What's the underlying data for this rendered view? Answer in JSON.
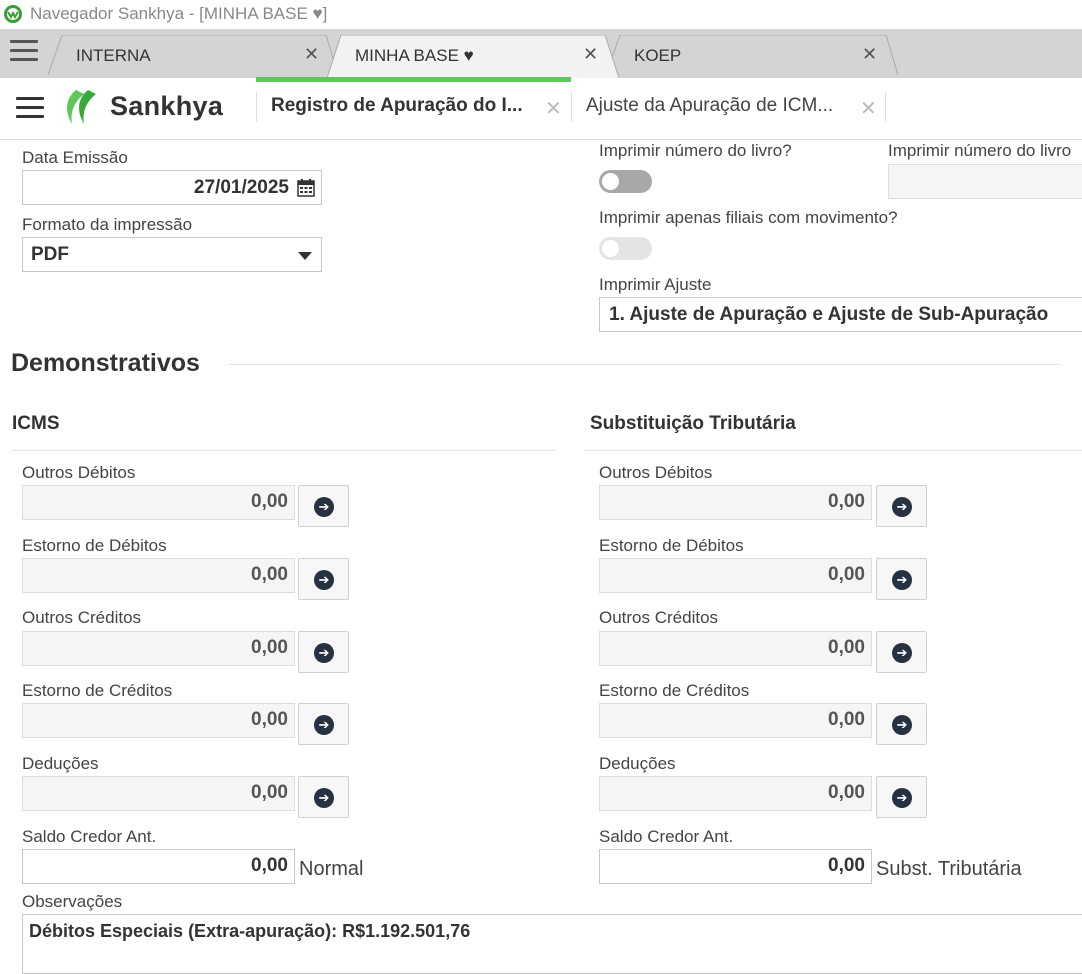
{
  "window": {
    "title": "Navegador Sankhya - [MINHA BASE ♥]"
  },
  "browser_tabs": [
    {
      "label": "INTERNA"
    },
    {
      "label": "MINHA BASE ♥"
    },
    {
      "label": "KOEP"
    }
  ],
  "app": {
    "brand": "Sankhya",
    "tabs": [
      {
        "label": "Registro de Apuração do I..."
      },
      {
        "label": "Ajuste da Apuração de ICM..."
      }
    ]
  },
  "form": {
    "data_emissao_label": "Data Emissão",
    "data_emissao_value": "27/01/2025",
    "formato_label": "Formato da impressão",
    "formato_value": "PDF",
    "imprimir_numero_label": "Imprimir número do livro?",
    "imprimir_numero_livro_label": "Imprimir número do livro",
    "imprimir_filiais_label": "Imprimir apenas filiais com movimento?",
    "imprimir_ajuste_label": "Imprimir Ajuste",
    "imprimir_ajuste_value": "1. Ajuste de Apuração e Ajuste de Sub-Apuração"
  },
  "demonstrativos": {
    "title": "Demonstrativos",
    "icms": {
      "title": "ICMS",
      "fields": [
        {
          "label": "Outros Débitos",
          "value": "0,00"
        },
        {
          "label": "Estorno de Débitos",
          "value": "0,00"
        },
        {
          "label": "Outros Créditos",
          "value": "0,00"
        },
        {
          "label": "Estorno de Créditos",
          "value": "0,00"
        },
        {
          "label": "Deduções",
          "value": "0,00"
        }
      ],
      "saldo_label": "Saldo Credor Ant.",
      "saldo_value": "0,00",
      "saldo_suffix": "Normal"
    },
    "st": {
      "title": "Substituição Tributária",
      "fields": [
        {
          "label": "Outros Débitos",
          "value": "0,00"
        },
        {
          "label": "Estorno de Débitos",
          "value": "0,00"
        },
        {
          "label": "Outros Créditos",
          "value": "0,00"
        },
        {
          "label": "Estorno de Créditos",
          "value": "0,00"
        },
        {
          "label": "Deduções",
          "value": "0,00"
        }
      ],
      "saldo_label": "Saldo Credor Ant.",
      "saldo_value": "0,00",
      "saldo_suffix": "Subst. Tributária"
    },
    "observacoes_label": "Observações",
    "observacoes_value": "Débitos Especiais (Extra-apuração): R$1.192.501,76"
  },
  "colors": {
    "accent": "#5cc85a",
    "arrow_button": "#263142",
    "toggle_off": "#c8c8c8"
  },
  "icons": [
    "app-logo-icon",
    "menu-icon",
    "close-icon",
    "calendar-icon",
    "dropdown-caret-icon",
    "arrow-right-icon",
    "sankhya-logo-icon"
  ]
}
